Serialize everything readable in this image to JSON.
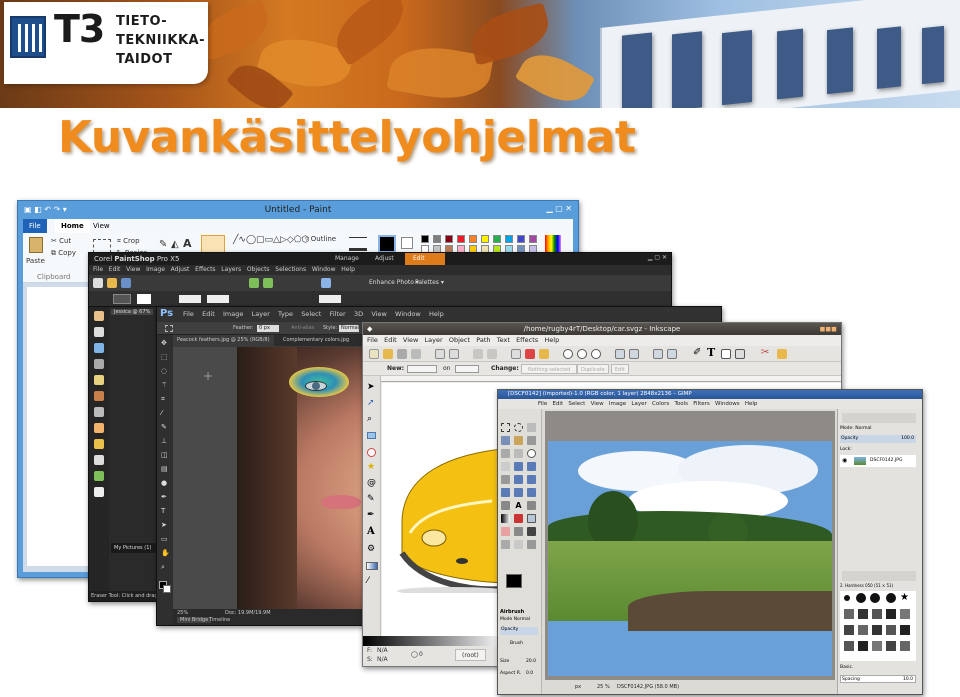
{
  "header": {
    "logo_mark": "T3",
    "logo_lines": [
      "TIETO-",
      "TEKNIIKKA-",
      "TAIDOT"
    ]
  },
  "slide_title": "Kuvankäsittelyohjelmat",
  "paint": {
    "window_title": "Untitled - Paint",
    "tabs": [
      "File",
      "Home",
      "View"
    ],
    "ribbon": {
      "paste": "Paste",
      "cut": "Cut",
      "copy": "Copy",
      "crop": "Crop",
      "resize": "Resize",
      "clipboard": "Clipboard",
      "outline": "Outline"
    }
  },
  "paintshop": {
    "window_title_prefix": "Corel ",
    "window_title_bold": "PaintShop",
    "window_title_suffix": " Pro X5",
    "modes": [
      "Manage",
      "Adjust",
      "Edit"
    ],
    "menu": [
      "File",
      "Edit",
      "View",
      "Image",
      "Adjust",
      "Effects",
      "Layers",
      "Objects",
      "Selections",
      "Window",
      "Help"
    ],
    "enhance": "Enhance Photo ▾",
    "palettes": "Palettes ▾",
    "doc_tab": "Jessica @ 67%",
    "my_pictures": "My Pictures (1)",
    "status": "Eraser Tool: Click and drag to e"
  },
  "photoshop": {
    "logo": "Ps",
    "menu": [
      "File",
      "Edit",
      "Image",
      "Layer",
      "Type",
      "Select",
      "Filter",
      "3D",
      "View",
      "Window",
      "Help"
    ],
    "options": {
      "feather_label": "Feather:",
      "feather_value": "0 px",
      "antialias": "Anti-alias",
      "style_label": "Style:",
      "style_value": "Normal"
    },
    "doc_tabs": [
      "Peacock feathers.jpg @ 25% (RGB/8)",
      "Complementary colors.jpg"
    ],
    "zoom": "25%",
    "doc_info": "Doc: 19.9M/19.9M",
    "bottom_tabs": [
      "Mini Bridge",
      "Timeline"
    ]
  },
  "inkscape": {
    "window_title": "/home/rugby4rT/Desktop/car.svgz - Inkscape",
    "menu": [
      "File",
      "Edit",
      "View",
      "Layer",
      "Object",
      "Path",
      "Text",
      "Effects",
      "Help"
    ],
    "ctrl": {
      "new_label": "New:",
      "on_label": "on",
      "change_label": "Change:",
      "no_selection": "Nothing selected",
      "duplicate": "Duplicate",
      "edit": "Edit"
    },
    "status": {
      "fill_label": "F:",
      "stroke_label": "S:",
      "fill_value": "N/A",
      "stroke_value": "N/A",
      "opacity": "0",
      "layer": "(root)"
    }
  },
  "gimp": {
    "window_title": "[DSCF0142] (imported)-1.0 (RGB color, 1 layer) 2848x2136 – GIMP",
    "menu": [
      "File",
      "Edit",
      "Select",
      "View",
      "Image",
      "Layer",
      "Colors",
      "Tools",
      "Filters",
      "Windows",
      "Help"
    ],
    "dock": {
      "mode_label": "Mode:",
      "mode_value": "Normal",
      "opacity": "Opacity",
      "opacity_value": "100.0",
      "lock": "Lock:",
      "layer_name": "DSCF0142.JPG",
      "brush_name": "2. Hardness 050 (51 × 51)",
      "basic": "Basic.",
      "spacing": "Spacing",
      "spacing_value": "10.0"
    },
    "tool_options": {
      "title": "Airbrush",
      "mode": "Mode Normal",
      "opacity": "Opacity",
      "brush": "Brush",
      "size": "Size",
      "size_value": "20.0",
      "aspect": "Aspect R.",
      "aspect_value": "0.0"
    },
    "status": {
      "unit": "px",
      "zoom": "25 %",
      "file": "DSCF0142.JPG (58.0 MB)"
    }
  }
}
